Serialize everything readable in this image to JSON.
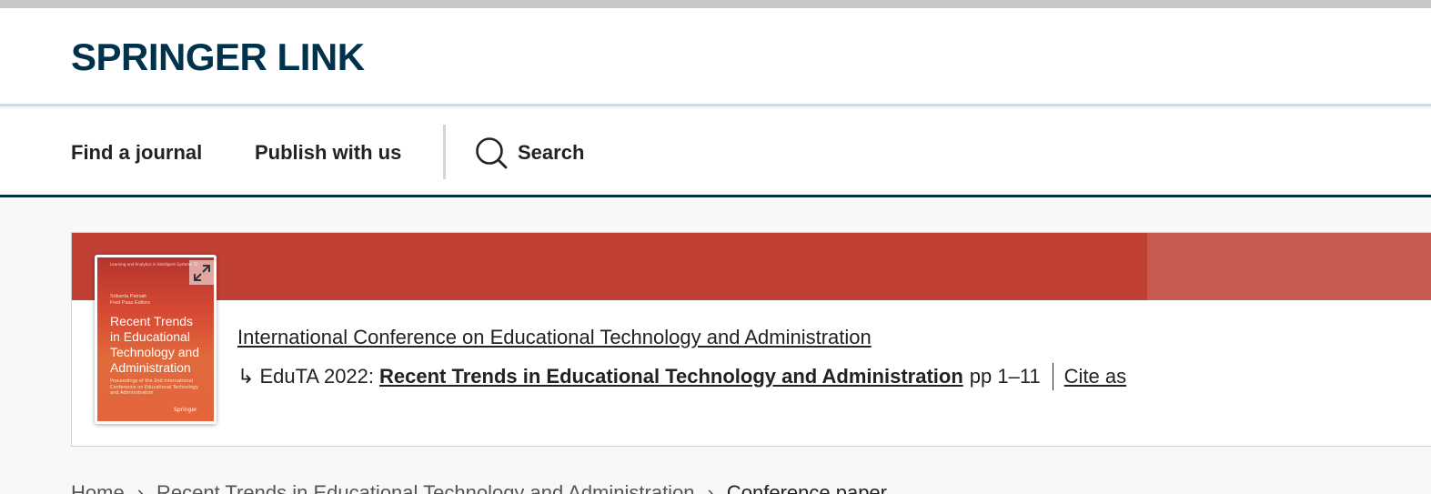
{
  "brand": {
    "logo_text": "SPRINGER LINK"
  },
  "nav": {
    "find_journal": "Find a journal",
    "publish": "Publish with us",
    "search": "Search"
  },
  "cover": {
    "series": "Learning and Analytics in Intelligent Systems 32",
    "editors": "Srikanta Patnaik\nFred Paas Editors",
    "title": "Recent Trends\nin Educational\nTechnology and\nAdministration",
    "subtitle": "Proceedings of the 2nd International\nConference on Educational Technology\nand Administration",
    "publisher": "Springer"
  },
  "context": {
    "conference": "International Conference on Educational Technology and Administration",
    "arrow": "↳",
    "event": "EduTA 2022:",
    "book_title": "Recent Trends in Educational Technology and Administration",
    "pages": "pp 1–11",
    "cite": "Cite as"
  },
  "breadcrumb": {
    "home": "Home",
    "book": "Recent Trends in Educational Technology and Administration",
    "current": "Conference paper",
    "separator": "›"
  },
  "colors": {
    "brand": "#01324b",
    "banner": "#c04035",
    "banner_light": "#c85a50"
  }
}
